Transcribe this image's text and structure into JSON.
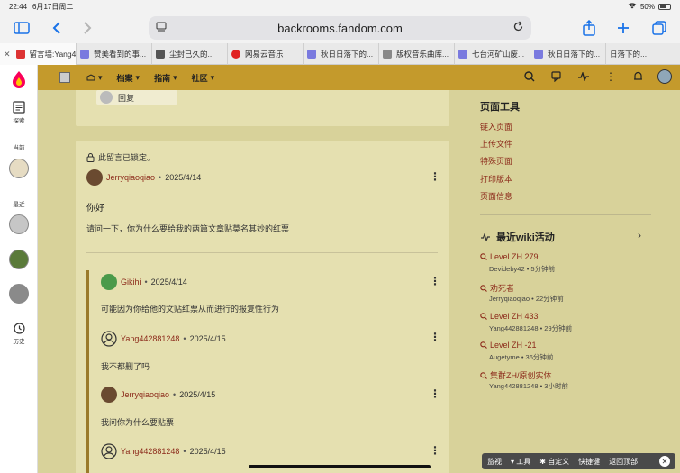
{
  "status": {
    "time": "22:44",
    "date": "6月17日周二",
    "battery": "50%"
  },
  "browser": {
    "url": "backrooms.fandom.com"
  },
  "tabs": [
    {
      "label": "留言墙:Yang4...",
      "color": "#d33"
    },
    {
      "label": "赞美看到的事...",
      "color": "#7a7adf"
    },
    {
      "label": "尘封已久的...",
      "color": "#555"
    },
    {
      "label": "网易云音乐",
      "color": "#e02020"
    },
    {
      "label": "秋日日落下的...",
      "color": "#7a7adf"
    },
    {
      "label": "版权音乐曲库...",
      "color": "#888"
    },
    {
      "label": "七台河矿山废...",
      "color": "#7a7adf"
    },
    {
      "label": "秋日日落下的...",
      "color": "#7a7adf"
    },
    {
      "label": "日落下的...",
      "color": "#7a7adf"
    }
  ],
  "rail": {
    "explore": "探索",
    "current": "当前",
    "recent": "最近",
    "history": "历史"
  },
  "wikinav": {
    "items": [
      "档案",
      "指南",
      "社区"
    ]
  },
  "thread_top": {
    "reply": "回复"
  },
  "thread": {
    "locked": "此留言已锁定。",
    "author": "Jerryqiaoqiao",
    "date": "2025/4/14",
    "title": "你好",
    "body": "请问一下，你为什么要给我的两篇文章贴莫名其妙的红票",
    "replies": [
      {
        "author": "Gikihi",
        "date": "2025/4/14",
        "body": "可能因为你给他的文贴红票从而进行的报复性行为"
      },
      {
        "author": "Yang442881248",
        "date": "2025/4/15",
        "body": "我不都删了吗"
      },
      {
        "author": "Jerryqiaoqiao",
        "date": "2025/4/15",
        "body": "我问你为什么要贴票"
      },
      {
        "author": "Yang442881248",
        "date": "2025/4/15",
        "body": ""
      }
    ]
  },
  "sidebar": {
    "tools_title": "页面工具",
    "tools": [
      "链入页面",
      "上传文件",
      "特殊页面",
      "打印版本",
      "页面信息"
    ],
    "activity_title": "最近wiki活动",
    "activity": [
      {
        "title": "Level ZH 279",
        "meta": "Devideby42 • 5分钟前"
      },
      {
        "title": "劝死者",
        "meta": "Jerryqiaoqiao • 22分钟前"
      },
      {
        "title": "Level ZH 433",
        "meta": "Yang442881248 • 29分钟前"
      },
      {
        "title": "Level ZH -21",
        "meta": "Augetyme • 36分钟前"
      },
      {
        "title": "集群ZH/原创实体",
        "meta": "Yang442881248 • 3小时前"
      }
    ]
  },
  "bottombar": {
    "items": [
      "监视",
      "工具",
      "自定义",
      "快捷键",
      "返回顶部"
    ]
  },
  "colors": {
    "accent": "#c49a2c",
    "link": "#8c2a1a",
    "bg": "#d8d29a",
    "card": "#e5e0b0"
  }
}
